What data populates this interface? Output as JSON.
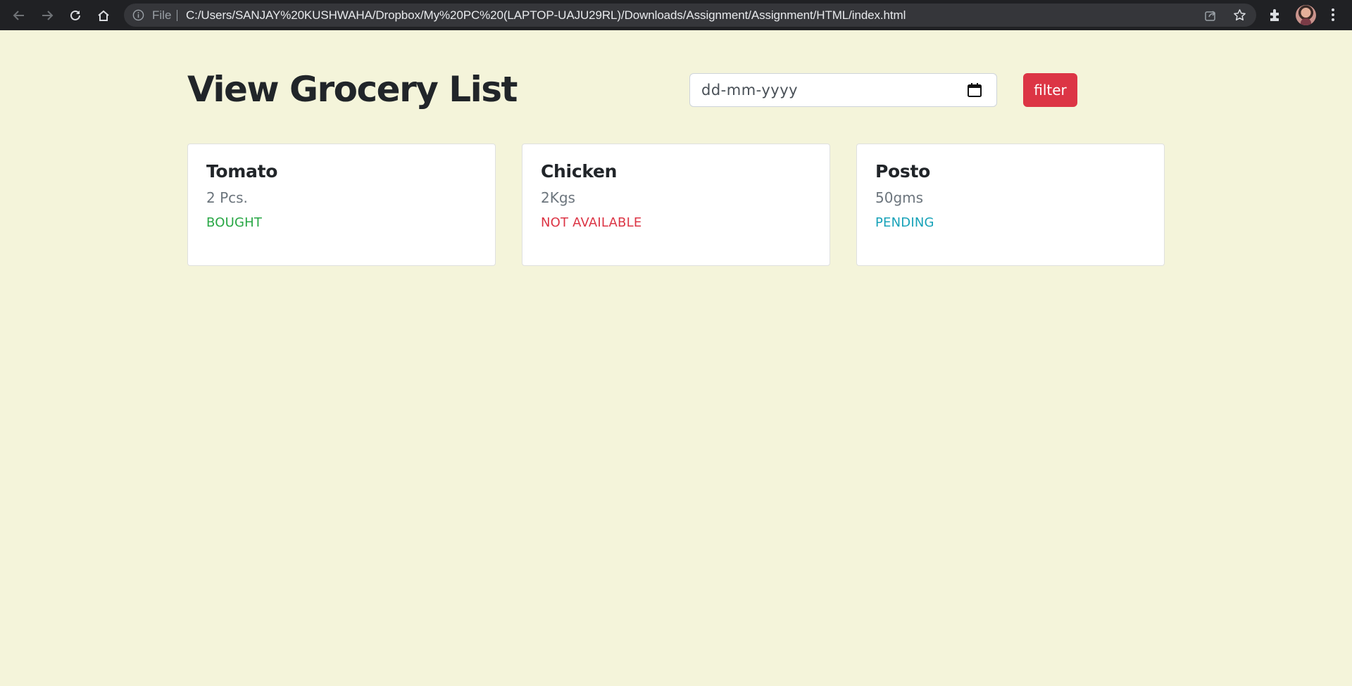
{
  "browser": {
    "scheme_label": "File",
    "url": "C:/Users/SANJAY%20KUSHWAHA/Dropbox/My%20PC%20(LAPTOP-UAJU29RL)/Downloads/Assignment/Assignment/HTML/index.html"
  },
  "page": {
    "title": "View Grocery List",
    "date_placeholder": "dd-mm-yyyy",
    "filter_label": "filter"
  },
  "items": [
    {
      "name": "Tomato",
      "quantity": "2 Pcs.",
      "status": "BOUGHT",
      "status_color": "#28a745"
    },
    {
      "name": "Chicken",
      "quantity": "2Kgs",
      "status": "NOT AVAILABLE",
      "status_color": "#dc3545"
    },
    {
      "name": "Posto",
      "quantity": "50gms",
      "status": "PENDING",
      "status_color": "#17a2b8"
    }
  ],
  "colors": {
    "background": "#f4f4da",
    "accent": "#dc3545"
  }
}
